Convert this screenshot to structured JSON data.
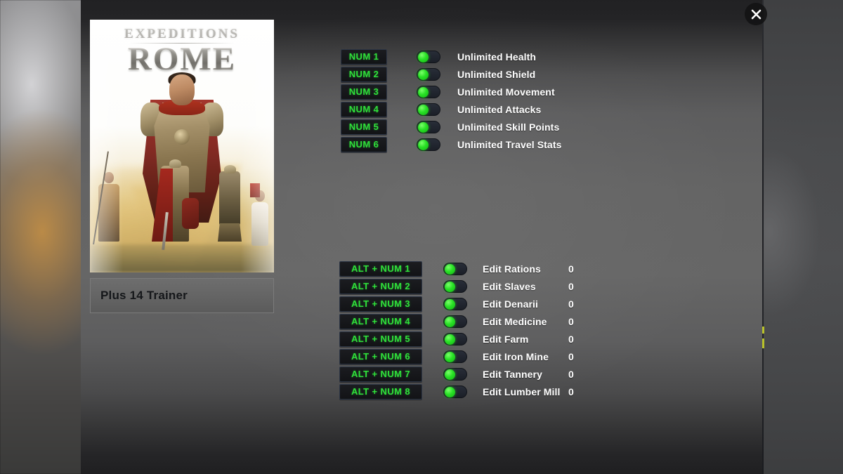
{
  "window": {
    "close_label": "×",
    "close_icon": "close-icon"
  },
  "cover": {
    "logo_top": "EXPEDITIONS",
    "logo_main": "ROME",
    "title": "Plus 14 Trainer"
  },
  "colors": {
    "hotkey_text": "#2fe03a",
    "hotkey_bg": "#15161a",
    "toggle_on": "#28e025",
    "toggle_track": "#232833",
    "label_text": "#ffffff",
    "panel_bg": "#646464",
    "panel_edge": "#212123"
  },
  "cheats": [
    {
      "hotkey": "NUM 1",
      "label": "Unlimited Health",
      "state": "on"
    },
    {
      "hotkey": "NUM 2",
      "label": "Unlimited Shield",
      "state": "on"
    },
    {
      "hotkey": "NUM 3",
      "label": "Unlimited Movement",
      "state": "on"
    },
    {
      "hotkey": "NUM 4",
      "label": "Unlimited Attacks",
      "state": "on"
    },
    {
      "hotkey": "NUM 5",
      "label": "Unlimited Skill Points",
      "state": "on"
    },
    {
      "hotkey": "NUM 6",
      "label": "Unlimited Travel Stats",
      "state": "on"
    }
  ],
  "edits": [
    {
      "hotkey": "ALT + NUM 1",
      "label": "Edit Rations",
      "value": "0",
      "state": "on"
    },
    {
      "hotkey": "ALT + NUM 2",
      "label": "Edit Slaves",
      "value": "0",
      "state": "on"
    },
    {
      "hotkey": "ALT + NUM 3",
      "label": "Edit Denarii",
      "value": "0",
      "state": "on"
    },
    {
      "hotkey": "ALT + NUM 4",
      "label": "Edit Medicine",
      "value": "0",
      "state": "on"
    },
    {
      "hotkey": "ALT + NUM 5",
      "label": "Edit Farm",
      "value": "0",
      "state": "on"
    },
    {
      "hotkey": "ALT + NUM 6",
      "label": "Edit Iron Mine",
      "value": "0",
      "state": "on"
    },
    {
      "hotkey": "ALT + NUM 7",
      "label": "Edit Tannery",
      "value": "0",
      "state": "on"
    },
    {
      "hotkey": "ALT + NUM 8",
      "label": "Edit Lumber Mill",
      "value": "0",
      "state": "on"
    }
  ]
}
